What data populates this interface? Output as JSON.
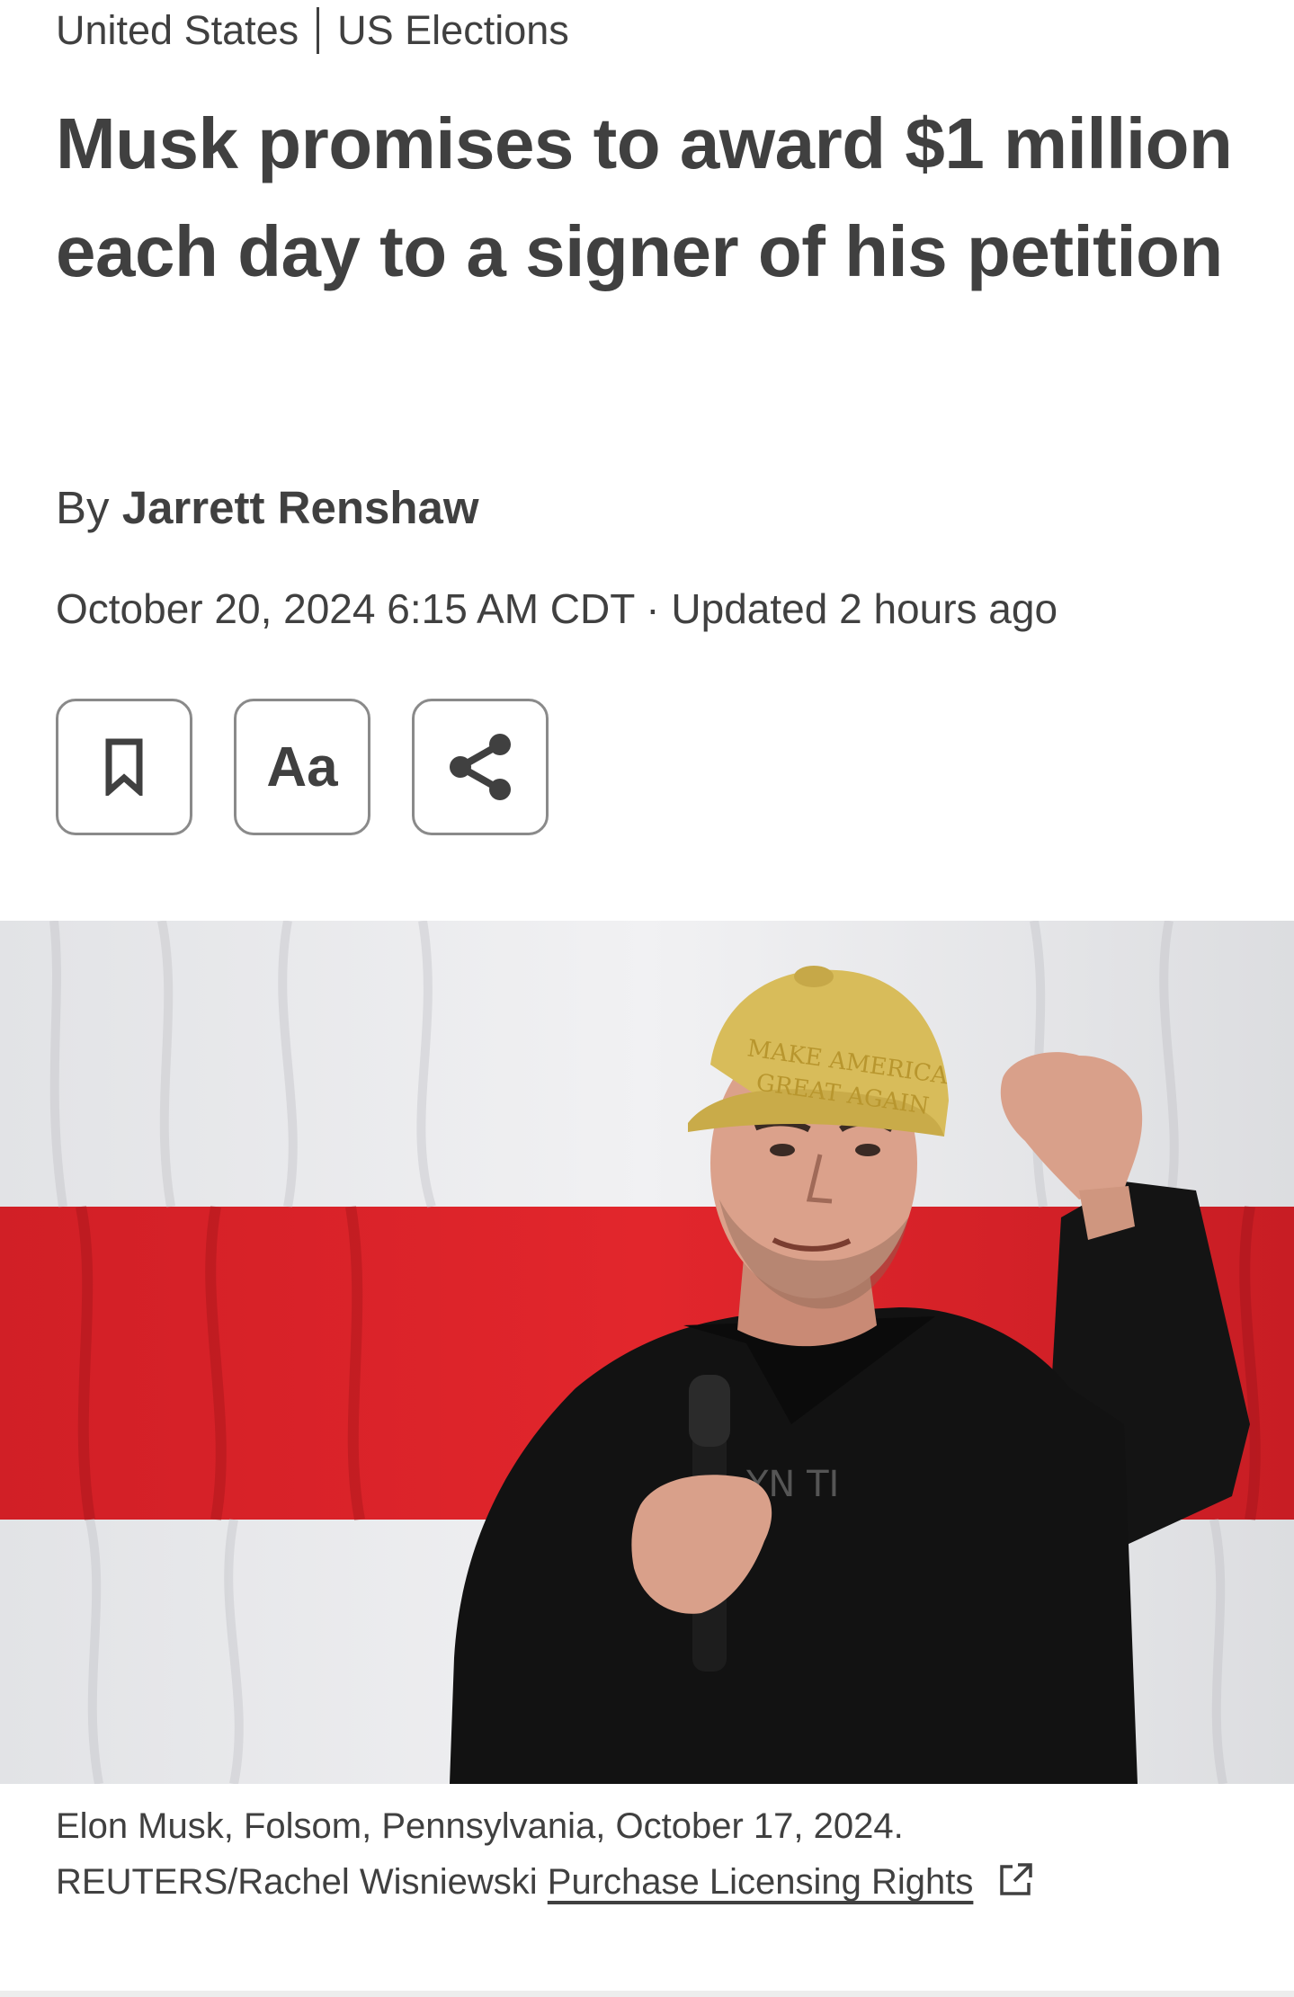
{
  "breadcrumb": {
    "section": "United States",
    "subsection": "US Elections"
  },
  "article": {
    "headline": "Musk promises to award $1 million each day to a signer of his petition",
    "byline_prefix": "By",
    "author": "Jarrett Renshaw",
    "dateline": "October 20, 2024 6:15 AM CDT · Updated 2 hours ago"
  },
  "toolbar": {
    "bookmark_icon": "bookmark-icon",
    "text_size_label": "Aa",
    "share_icon": "share-icon"
  },
  "image": {
    "cap_text_line1": "MAKE AMERICA",
    "cap_text_line2": "GREAT AGAIN",
    "shirt_text": "YN TI"
  },
  "caption": {
    "text": "Elon Musk, Folsom, Pennsylvania, October 17, 2024.",
    "credit": "REUTERS/Rachel Wisniewski",
    "licensing_link": "Purchase Licensing Rights",
    "external_icon": "external-link-icon"
  },
  "colors": {
    "text": "#404040",
    "flag_red": "#d91f26",
    "flag_white": "#e9e9ec",
    "cap_yellow": "#d9bd5c",
    "jacket": "#121212"
  }
}
